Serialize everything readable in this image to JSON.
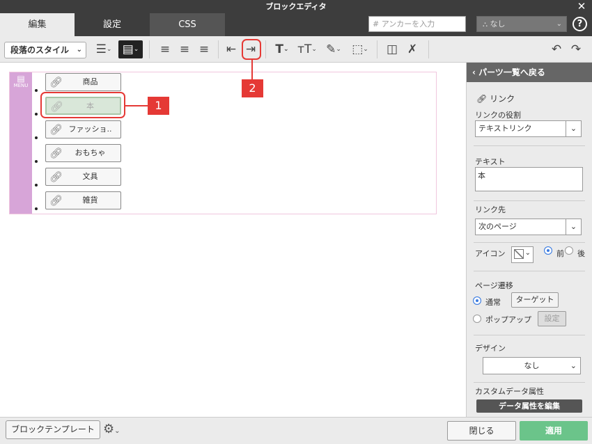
{
  "window": {
    "title": "ブロックエディタ",
    "close": "✕"
  },
  "tabs": [
    {
      "label": "編集"
    },
    {
      "label": "設定"
    },
    {
      "label": "CSS"
    }
  ],
  "anchor": {
    "placeholder": "アンカーを入力",
    "hash": "#"
  },
  "class_select": {
    "value": "なし"
  },
  "toolbar": {
    "paragraph_style": "段落のスタイル"
  },
  "menu_block": {
    "label": "MENU",
    "items": [
      {
        "label": "商品"
      },
      {
        "label": "本"
      },
      {
        "label": "ファッショ.."
      },
      {
        "label": "おもちゃ"
      },
      {
        "label": "文具"
      },
      {
        "label": "雑貨"
      }
    ]
  },
  "callouts": [
    {
      "number": "1"
    },
    {
      "number": "2"
    }
  ],
  "panel": {
    "back": "パーツ一覧へ戻る",
    "section_title": "リンク",
    "role_label": "リンクの役割",
    "role_value": "テキストリンク",
    "text_label": "テキスト",
    "text_value": "本",
    "target_label": "リンク先",
    "target_value": "次のページ",
    "icon_label": "アイコン",
    "icon_pos_before": "前",
    "icon_pos_after": "後",
    "transition_label": "ページ遷移",
    "normal": "通常",
    "target_btn": "ターゲット",
    "popup": "ポップアップ",
    "settings_btn": "設定",
    "design_label": "デザイン",
    "design_value": "なし",
    "custom_attr_label": "カスタムデータ属性",
    "edit_attr_btn": "データ属性を編集"
  },
  "footer": {
    "block_template": "ブロックテンプレート",
    "close": "閉じる",
    "apply": "適用"
  },
  "colors": {
    "titlebar": "#3d3d3d",
    "accent_green": "#6bc48a",
    "callout_red": "#e53935",
    "menu_strip": "#d7a5d8"
  }
}
